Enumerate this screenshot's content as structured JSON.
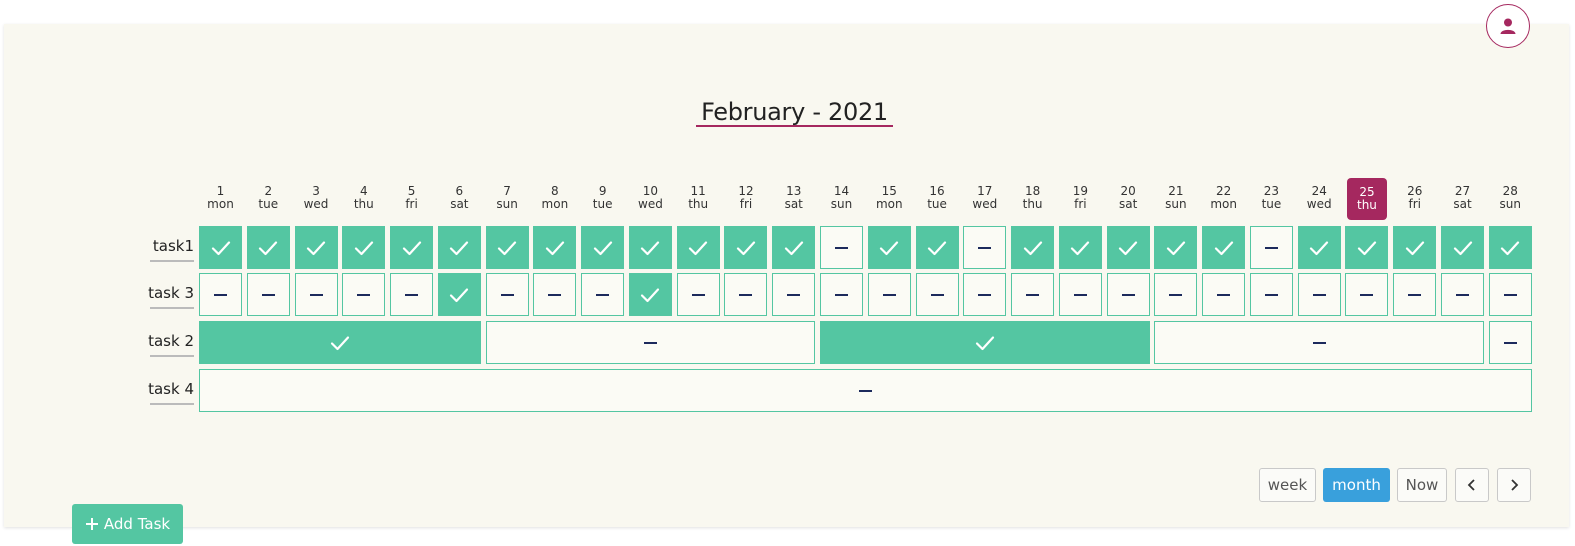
{
  "calendar": {
    "title": "February - 2021",
    "today_index": 24,
    "days": [
      {
        "num": "1",
        "dow": "mon"
      },
      {
        "num": "2",
        "dow": "tue"
      },
      {
        "num": "3",
        "dow": "wed"
      },
      {
        "num": "4",
        "dow": "thu"
      },
      {
        "num": "5",
        "dow": "fri"
      },
      {
        "num": "6",
        "dow": "sat"
      },
      {
        "num": "7",
        "dow": "sun"
      },
      {
        "num": "8",
        "dow": "mon"
      },
      {
        "num": "9",
        "dow": "tue"
      },
      {
        "num": "10",
        "dow": "wed"
      },
      {
        "num": "11",
        "dow": "thu"
      },
      {
        "num": "12",
        "dow": "fri"
      },
      {
        "num": "13",
        "dow": "sat"
      },
      {
        "num": "14",
        "dow": "sun"
      },
      {
        "num": "15",
        "dow": "mon"
      },
      {
        "num": "16",
        "dow": "tue"
      },
      {
        "num": "17",
        "dow": "wed"
      },
      {
        "num": "18",
        "dow": "thu"
      },
      {
        "num": "19",
        "dow": "fri"
      },
      {
        "num": "20",
        "dow": "sat"
      },
      {
        "num": "21",
        "dow": "sun"
      },
      {
        "num": "22",
        "dow": "mon"
      },
      {
        "num": "23",
        "dow": "tue"
      },
      {
        "num": "24",
        "dow": "wed"
      },
      {
        "num": "25",
        "dow": "thu"
      },
      {
        "num": "26",
        "dow": "fri"
      },
      {
        "num": "27",
        "dow": "sat"
      },
      {
        "num": "28",
        "dow": "sun"
      }
    ]
  },
  "tasks": [
    {
      "label": "task1",
      "cells": [
        {
          "span": 1,
          "done": true
        },
        {
          "span": 1,
          "done": true
        },
        {
          "span": 1,
          "done": true
        },
        {
          "span": 1,
          "done": true
        },
        {
          "span": 1,
          "done": true
        },
        {
          "span": 1,
          "done": true
        },
        {
          "span": 1,
          "done": true
        },
        {
          "span": 1,
          "done": true
        },
        {
          "span": 1,
          "done": true
        },
        {
          "span": 1,
          "done": true
        },
        {
          "span": 1,
          "done": true
        },
        {
          "span": 1,
          "done": true
        },
        {
          "span": 1,
          "done": true
        },
        {
          "span": 1,
          "done": false
        },
        {
          "span": 1,
          "done": true
        },
        {
          "span": 1,
          "done": true
        },
        {
          "span": 1,
          "done": false
        },
        {
          "span": 1,
          "done": true
        },
        {
          "span": 1,
          "done": true
        },
        {
          "span": 1,
          "done": true
        },
        {
          "span": 1,
          "done": true
        },
        {
          "span": 1,
          "done": true
        },
        {
          "span": 1,
          "done": false
        },
        {
          "span": 1,
          "done": true
        },
        {
          "span": 1,
          "done": true
        },
        {
          "span": 1,
          "done": true
        },
        {
          "span": 1,
          "done": true
        },
        {
          "span": 1,
          "done": true
        }
      ]
    },
    {
      "label": "task 3",
      "cells": [
        {
          "span": 1,
          "done": false
        },
        {
          "span": 1,
          "done": false
        },
        {
          "span": 1,
          "done": false
        },
        {
          "span": 1,
          "done": false
        },
        {
          "span": 1,
          "done": false
        },
        {
          "span": 1,
          "done": true
        },
        {
          "span": 1,
          "done": false
        },
        {
          "span": 1,
          "done": false
        },
        {
          "span": 1,
          "done": false
        },
        {
          "span": 1,
          "done": true
        },
        {
          "span": 1,
          "done": false
        },
        {
          "span": 1,
          "done": false
        },
        {
          "span": 1,
          "done": false
        },
        {
          "span": 1,
          "done": false
        },
        {
          "span": 1,
          "done": false
        },
        {
          "span": 1,
          "done": false
        },
        {
          "span": 1,
          "done": false
        },
        {
          "span": 1,
          "done": false
        },
        {
          "span": 1,
          "done": false
        },
        {
          "span": 1,
          "done": false
        },
        {
          "span": 1,
          "done": false
        },
        {
          "span": 1,
          "done": false
        },
        {
          "span": 1,
          "done": false
        },
        {
          "span": 1,
          "done": false
        },
        {
          "span": 1,
          "done": false
        },
        {
          "span": 1,
          "done": false
        },
        {
          "span": 1,
          "done": false
        },
        {
          "span": 1,
          "done": false
        }
      ]
    },
    {
      "label": "task 2",
      "cells": [
        {
          "span": 6,
          "done": true
        },
        {
          "span": 7,
          "done": false
        },
        {
          "span": 7,
          "done": true
        },
        {
          "span": 7,
          "done": false
        },
        {
          "span": 1,
          "done": false
        }
      ]
    },
    {
      "label": "task 4",
      "cells": [
        {
          "span": 28,
          "done": false
        }
      ]
    }
  ],
  "controls": {
    "week": "week",
    "month": "month",
    "now": "Now",
    "active_view": "month"
  },
  "add_task": {
    "label": "Add Task"
  },
  "icons": {
    "avatar": "user-icon",
    "prev": "chevron-left-icon",
    "next": "chevron-right-icon",
    "done": "check-icon",
    "pending": "dash-icon",
    "add": "plus-icon"
  },
  "colors": {
    "accent": "#a5285f",
    "done": "#54c6a2",
    "active_button": "#39a0dc",
    "dash": "#1c2a5c"
  }
}
